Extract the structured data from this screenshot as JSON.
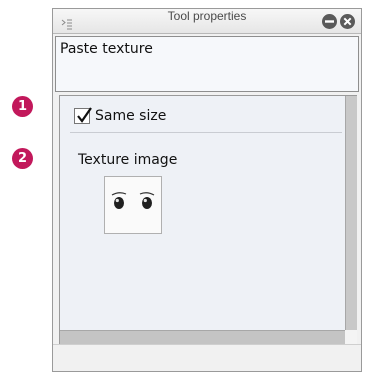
{
  "callouts": {
    "first": "1",
    "second": "2"
  },
  "window": {
    "title": "Tool properties"
  },
  "header": {
    "label": "Paste texture"
  },
  "properties": {
    "same_size": {
      "label": "Same size",
      "checked": true
    },
    "texture_image": {
      "label": "Texture image"
    }
  },
  "colors": {
    "callout": "#c2185b",
    "panel_bg": "#eef1f6",
    "scrollbar": "#c8c8c8"
  }
}
